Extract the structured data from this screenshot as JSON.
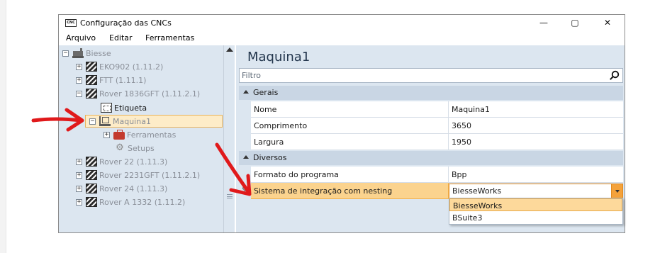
{
  "window": {
    "title": "Configuração das CNCs",
    "app_icon_text": "CNC",
    "minimize": "—",
    "maximize": "▢",
    "close": "✕"
  },
  "menu": [
    "Arquivo",
    "Editar",
    "Ferramentas"
  ],
  "tree": [
    {
      "label": "Biesse",
      "icon": "factory-icon",
      "expander": "−",
      "muted": true
    },
    {
      "label": "EKO902 (1.11.2)",
      "icon": "machine-icon",
      "expander": "+",
      "muted": true
    },
    {
      "label": "FTT (1.11.1)",
      "icon": "machine-icon",
      "expander": "+",
      "muted": true
    },
    {
      "label": "Rover 1836GFT (1.11.2.1)",
      "icon": "machine-icon",
      "expander": "−",
      "muted": true
    },
    {
      "label": "Etiqueta",
      "icon": "label-icon",
      "expander": "",
      "muted": false
    },
    {
      "label": "Maquina1",
      "icon": "machine-node-icon",
      "expander": "−",
      "muted": true,
      "selected": true
    },
    {
      "label": "Ferramentas",
      "icon": "toolbox-icon",
      "expander": "+",
      "muted": true
    },
    {
      "label": "Setups",
      "icon": "gear-icon",
      "expander": "",
      "muted": true
    },
    {
      "label": "Rover 22 (1.11.3)",
      "icon": "machine-icon",
      "expander": "+",
      "muted": true
    },
    {
      "label": "Rover 2231GFT (1.11.2.1)",
      "icon": "machine-icon",
      "expander": "+",
      "muted": true
    },
    {
      "label": "Rover 24 (1.11.3)",
      "icon": "machine-icon",
      "expander": "+",
      "muted": true
    },
    {
      "label": "Rover A 1332 (1.11.2)",
      "icon": "machine-icon",
      "expander": "+",
      "muted": true
    }
  ],
  "detail": {
    "title": "Maquina1",
    "filter_placeholder": "Filtro",
    "categories": [
      {
        "name": "Gerais",
        "properties": [
          {
            "name": "Nome",
            "value": "Maquina1"
          },
          {
            "name": "Comprimento",
            "value": "3650"
          },
          {
            "name": "Largura",
            "value": "1950"
          }
        ]
      },
      {
        "name": "Diversos",
        "properties": [
          {
            "name": "Formato do programa",
            "value": "Bpp"
          },
          {
            "name": "Sistema de integração com nesting",
            "value": "BiesseWorks",
            "editing": true
          }
        ]
      }
    ],
    "dropdown_options": [
      "BiesseWorks",
      "BSuite3"
    ],
    "dropdown_selected": "BiesseWorks"
  },
  "colors": {
    "accent": "#f4a23b",
    "selection": "#fdecc8",
    "panel": "#dce6f0",
    "annotation_arrow": "#e0191b"
  }
}
